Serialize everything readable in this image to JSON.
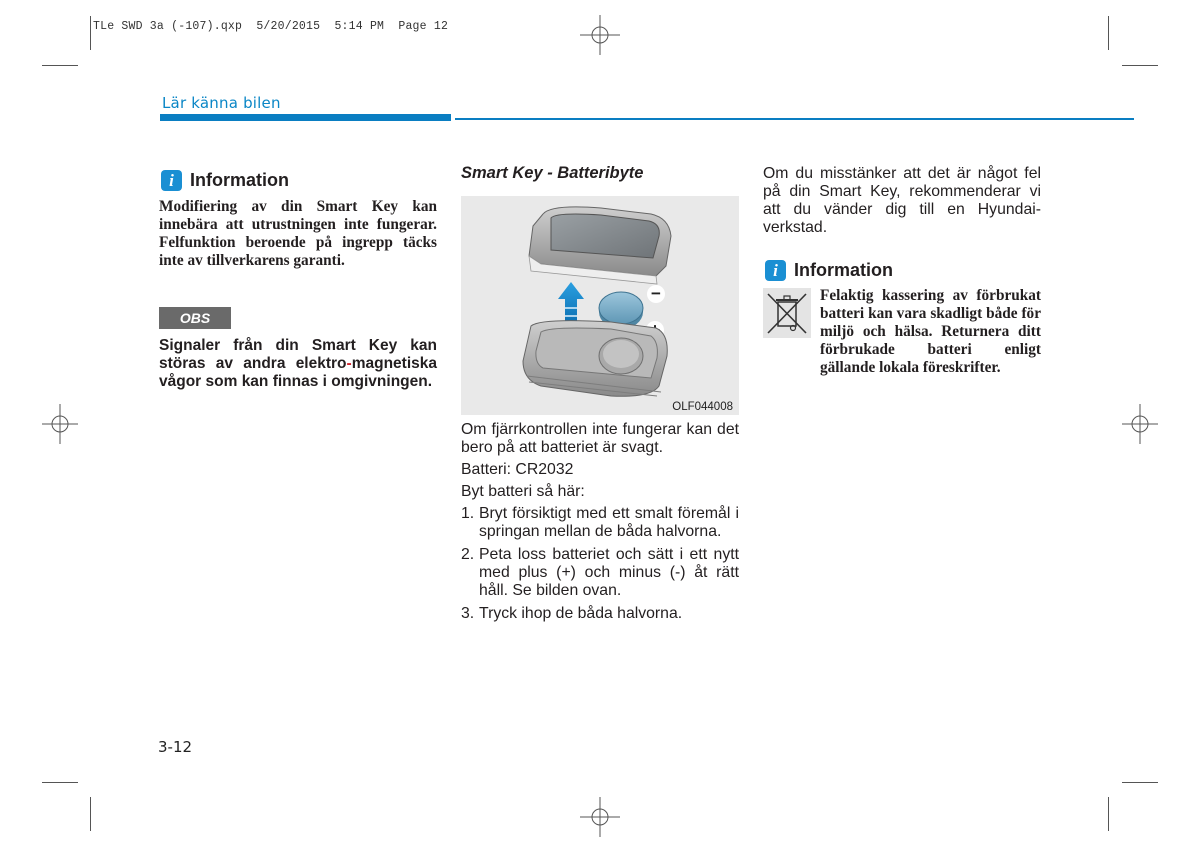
{
  "print_slug": "TLe SWD 3a (-107).qxp  5/20/2015  5:14 PM  Page 12",
  "header": {
    "section_title": "Lär känna bilen",
    "accent_color": "#0a7ec2"
  },
  "left_column": {
    "info": {
      "icon": "info-icon",
      "icon_glyph": "i",
      "title": "Information",
      "text": "Modifiering av din Smart Key kan innebära att utrustningen inte fungerar. Felfunktion beroende på ingrepp täcks inte av tillverkarens garanti."
    },
    "obs": {
      "label": "OBS",
      "text_part1": "Signaler från din Smart Key kan störas av andra elektro",
      "hyphen": "-",
      "text_part2": "magnetiska vågor som kan finnas i omgivningen."
    }
  },
  "middle_column": {
    "title": "Smart Key - Batteribyte",
    "figure": {
      "caption": "OLF044008",
      "minus_label": "−",
      "plus_label": "+"
    },
    "intro": "Om fjärrkontrollen inte fungerar kan det bero på att batteriet är svagt.",
    "battery": "Batteri: CR2032",
    "steps_heading": "Byt batteri så här:",
    "steps": [
      {
        "num": "1.",
        "text": "Bryt försiktigt med ett smalt föremål i springan mellan de båda halvorna."
      },
      {
        "num": "2.",
        "text": "Peta loss batteriet och sätt i ett nytt med plus (+) och minus (-) åt rätt håll. Se bilden ovan."
      },
      {
        "num": "3.",
        "text": "Tryck ihop de båda halvorna."
      }
    ]
  },
  "right_column": {
    "text": "Om du misstänker att det är något fel på din Smart Key, rekommenderar vi att du vänder dig till en Hyundai-verkstad.",
    "info": {
      "icon": "info-icon",
      "icon_glyph": "i",
      "title": "Information",
      "symbol": "crossed-out-wheelie-bin-icon",
      "text": "Felaktig kassering av förbrukat batteri kan vara skadligt både för miljö och hälsa. Returnera ditt förbrukade batteri enligt gällande lokala föreskrifter."
    }
  },
  "footer": {
    "page_number": "3-12"
  }
}
